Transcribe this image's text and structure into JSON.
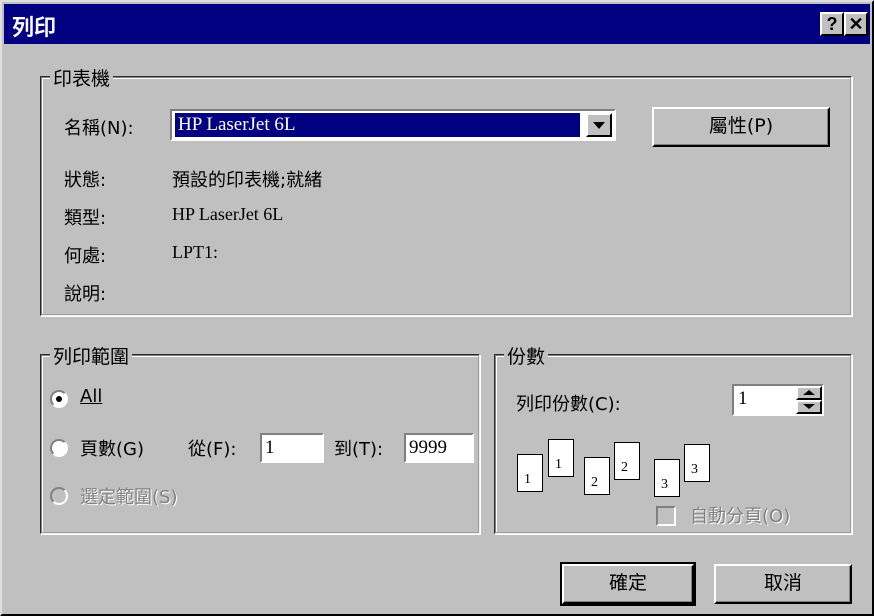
{
  "window": {
    "title": "列印",
    "help_label": "?",
    "close_label": "✕"
  },
  "printer": {
    "group_label": "印表機",
    "name_label": "名稱(N):",
    "name_value": "HP LaserJet 6L",
    "properties_label": "屬性(P)",
    "status_label": "狀態:",
    "status_value": "預設的印表機;就緒",
    "type_label": "類型:",
    "type_value": "HP LaserJet 6L",
    "where_label": "何處:",
    "where_value": "LPT1:",
    "comment_label": "說明:"
  },
  "range": {
    "group_label": "列印範圍",
    "all_label": "All",
    "pages_label": "頁數(G)",
    "from_label": "從(F):",
    "from_value": "1",
    "to_label": "到(T):",
    "to_value": "9999",
    "selection_label": "選定範圍(S)"
  },
  "copies": {
    "group_label": "份數",
    "count_label": "列印份數(C):",
    "count_value": "1",
    "collate_label": "自動分頁(O)",
    "pages": [
      "1",
      "1",
      "2",
      "2",
      "3",
      "3"
    ]
  },
  "buttons": {
    "ok_label": "確定",
    "cancel_label": "取消"
  }
}
